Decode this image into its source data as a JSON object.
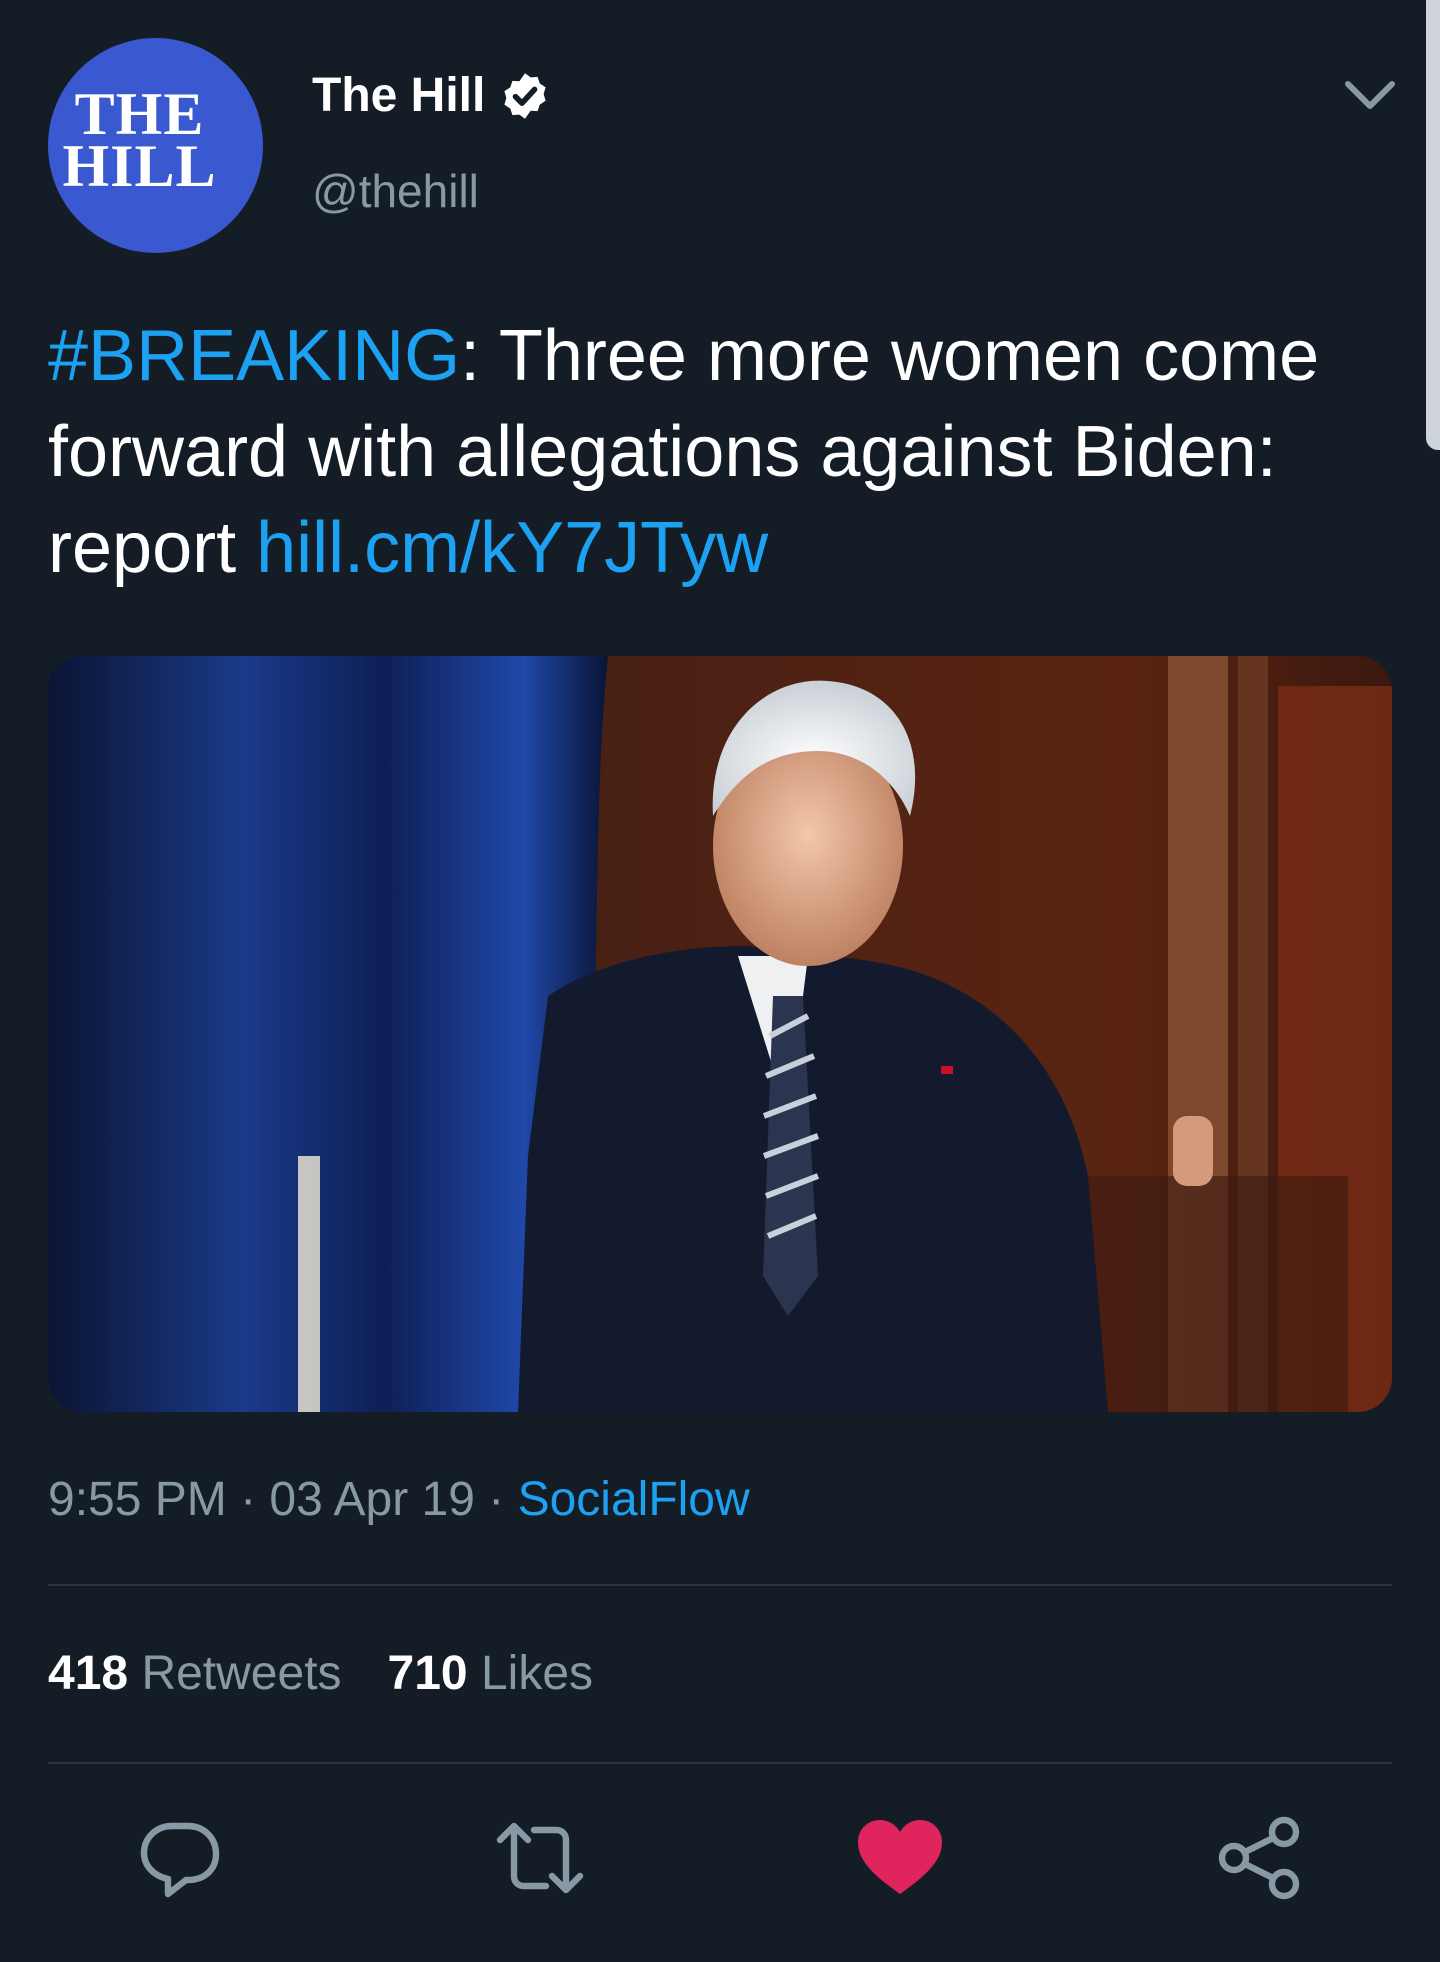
{
  "header": {
    "avatar_line1": "THE",
    "avatar_line2": "HILL",
    "display_name": "The Hill",
    "handle": "@thehill"
  },
  "tweet": {
    "hashtag": "#BREAKING",
    "text_after_hashtag": ": Three more women come forward with allegations against Biden: report ",
    "link": "hill.cm/kY7JTyw"
  },
  "meta": {
    "time": "9:55 PM",
    "sep1": " · ",
    "date": "03 Apr 19",
    "sep2": " · ",
    "source": "SocialFlow"
  },
  "stats": {
    "retweets_count": "418",
    "retweets_label": "Retweets",
    "likes_count": "710",
    "likes_label": "Likes"
  },
  "icons": {
    "verified": "verified-badge-icon",
    "menu": "chevron-down-icon",
    "reply": "reply-icon",
    "retweet": "retweet-icon",
    "like": "heart-icon",
    "share": "share-icon"
  },
  "colors": {
    "background": "#141d26",
    "link": "#1da1f2",
    "secondary_text": "#8899a6",
    "like_active": "#e0245e",
    "avatar_bg": "#3a58cf"
  }
}
